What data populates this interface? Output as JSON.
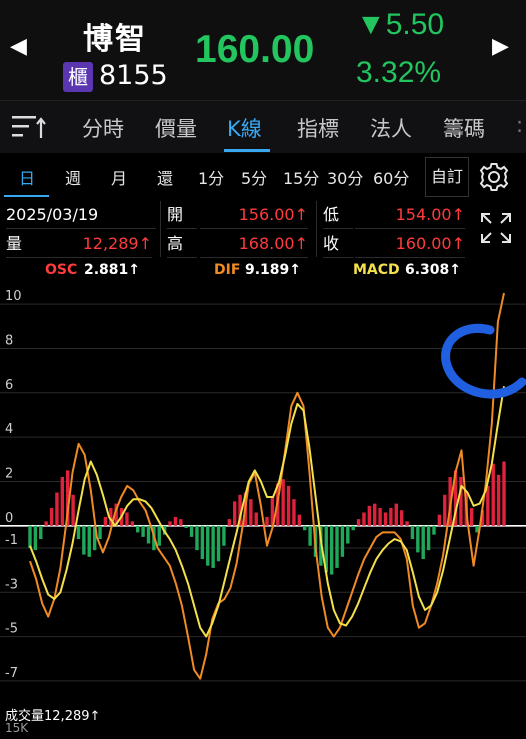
{
  "header": {
    "prev_icon": "chevron-left",
    "next_icon": "chevron-right",
    "name": "博智",
    "market_badge": "櫃",
    "code": "8155",
    "price": "160.00",
    "change": "▼5.50",
    "change_pct": "3.32%",
    "color_down": "#22c55e"
  },
  "tabs": {
    "menu_icon": "sort-menu-icon",
    "items": [
      {
        "label": "分時",
        "active": false
      },
      {
        "label": "價量",
        "active": false
      },
      {
        "label": "K線",
        "active": true
      },
      {
        "label": "指標",
        "active": false
      },
      {
        "label": "法人",
        "active": false
      },
      {
        "label": "籌碼",
        "active": false
      }
    ],
    "accent": "#38a8f0"
  },
  "periods": {
    "items": [
      "日",
      "週",
      "月",
      "還",
      "1分",
      "5分",
      "15分",
      "30分",
      "60分"
    ],
    "active": "日",
    "custom_label": "自訂",
    "settings_icon": "gear-icon"
  },
  "info": {
    "date": "2025/03/19",
    "open_label": "開",
    "open": "156.00↑",
    "low_label": "低",
    "low": "154.00↑",
    "volume_label": "量",
    "volume": "12,289↑",
    "high_label": "高",
    "high": "168.00↑",
    "close_label": "收",
    "close": "160.00↑",
    "up_color": "#ff3b3b",
    "expand_icon": "expand-icon"
  },
  "legend": {
    "osc_label": "OSC",
    "osc_value": "2.881↑",
    "dif_label": "DIF",
    "dif_value": "9.189↑",
    "macd_label": "MACD",
    "macd_value": "6.308↑",
    "osc_color": "#ff3b3b",
    "dif_color": "#f08a24",
    "macd_color": "#f3e04a"
  },
  "chart_data": {
    "type": "bar",
    "title": "",
    "ylim": [
      -7.5,
      11
    ],
    "yticks": [
      10,
      8,
      6,
      4,
      2,
      0,
      -1,
      -3,
      -5,
      -7
    ],
    "ytick_labels": [
      "10",
      "8",
      "6",
      "4",
      "2",
      "0",
      "-1",
      "-3",
      "-5",
      "-7"
    ],
    "series": [
      {
        "name": "OSC",
        "kind": "bar",
        "values": [
          -1.0,
          -1.1,
          -0.6,
          0.2,
          0.8,
          1.5,
          2.2,
          2.5,
          1.4,
          -0.6,
          -1.3,
          -1.4,
          -1.1,
          -0.6,
          0.4,
          0.8,
          1.0,
          0.8,
          0.6,
          0.2,
          -0.3,
          -0.5,
          -0.8,
          -1.1,
          -0.9,
          -0.4,
          0.2,
          0.4,
          0.3,
          -0.1,
          -0.5,
          -1.1,
          -1.5,
          -1.8,
          -1.9,
          -1.6,
          -0.9,
          0.3,
          1.1,
          1.4,
          1.5,
          1.2,
          0.6,
          0.0,
          0.4,
          1.3,
          1.9,
          2.1,
          1.8,
          1.2,
          0.5,
          -0.2,
          -0.9,
          -1.4,
          -1.8,
          -2.1,
          -2.2,
          -1.9,
          -1.4,
          -0.8,
          -0.2,
          0.3,
          0.6,
          0.9,
          1.0,
          0.8,
          0.6,
          0.8,
          1.0,
          0.7,
          0.2,
          -0.6,
          -1.2,
          -1.5,
          -1.1,
          -0.4,
          0.5,
          1.4,
          2.2,
          2.5,
          2.2,
          1.5,
          0.8,
          -0.3,
          0.7,
          1.8,
          2.8,
          2.3,
          2.9
        ]
      },
      {
        "name": "DIF",
        "kind": "line",
        "values": [
          -1.6,
          -2.4,
          -3.5,
          -4.1,
          -3.3,
          -1.9,
          0.2,
          2.4,
          3.7,
          3.2,
          1.6,
          -0.5,
          -1.2,
          -0.5,
          0.6,
          1.3,
          1.8,
          1.6,
          1.1,
          0.7,
          -0.1,
          -1.0,
          -1.4,
          -1.8,
          -2.6,
          -3.6,
          -5.0,
          -6.5,
          -6.9,
          -5.8,
          -4.2,
          -3.5,
          -3.3,
          -2.8,
          -1.7,
          0.0,
          1.9,
          2.4,
          0.9,
          -0.9,
          0.0,
          1.5,
          3.4,
          5.4,
          6.0,
          5.4,
          2.4,
          -1.0,
          -3.2,
          -4.6,
          -5.0,
          -4.6,
          -3.8,
          -3.0,
          -2.2,
          -1.5,
          -1.0,
          -0.5,
          -0.3,
          -0.3,
          -0.3,
          -0.6,
          -1.5,
          -3.6,
          -4.6,
          -4.4,
          -3.6,
          -2.6,
          -1.3,
          0.6,
          2.4,
          3.4,
          0.2,
          -1.8,
          -0.1,
          1.9,
          4.6,
          9.2,
          10.5
        ]
      },
      {
        "name": "MACD",
        "kind": "line",
        "values": [
          -0.9,
          -1.6,
          -2.4,
          -3.1,
          -3.3,
          -3.0,
          -2.0,
          -0.8,
          0.7,
          2.1,
          2.9,
          2.3,
          1.4,
          0.4,
          0.0,
          0.4,
          0.9,
          1.2,
          1.2,
          1.1,
          0.8,
          0.3,
          -0.2,
          -0.6,
          -1.1,
          -1.8,
          -2.6,
          -3.6,
          -4.6,
          -5.0,
          -4.4,
          -3.6,
          -2.5,
          -1.4,
          -0.3,
          0.9,
          2.0,
          2.5,
          2.0,
          1.3,
          1.3,
          2.0,
          3.2,
          4.6,
          5.5,
          5.2,
          3.5,
          1.3,
          -0.9,
          -2.6,
          -3.8,
          -4.4,
          -4.5,
          -4.1,
          -3.5,
          -2.8,
          -2.1,
          -1.5,
          -1.1,
          -0.8,
          -0.6,
          -0.7,
          -1.1,
          -2.1,
          -3.2,
          -3.8,
          -3.6,
          -3.0,
          -2.0,
          -0.7,
          0.6,
          1.8,
          1.5,
          0.9,
          1.0,
          1.6,
          2.8,
          4.6,
          6.3
        ]
      }
    ],
    "grid": true
  },
  "footer": {
    "volume_label": "成交量",
    "volume_value": "12,289↑",
    "scale_label": "15K"
  }
}
